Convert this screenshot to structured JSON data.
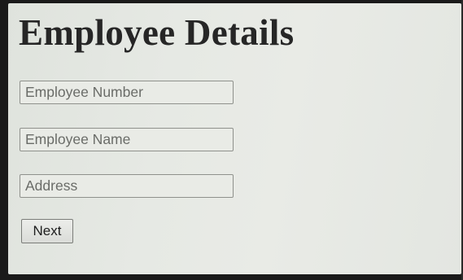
{
  "page": {
    "title": "Employee Details"
  },
  "form": {
    "employee_number": {
      "value": "",
      "placeholder": "Employee Number"
    },
    "employee_name": {
      "value": "",
      "placeholder": "Employee Name"
    },
    "address": {
      "value": "",
      "placeholder": "Address"
    },
    "next_label": "Next"
  }
}
